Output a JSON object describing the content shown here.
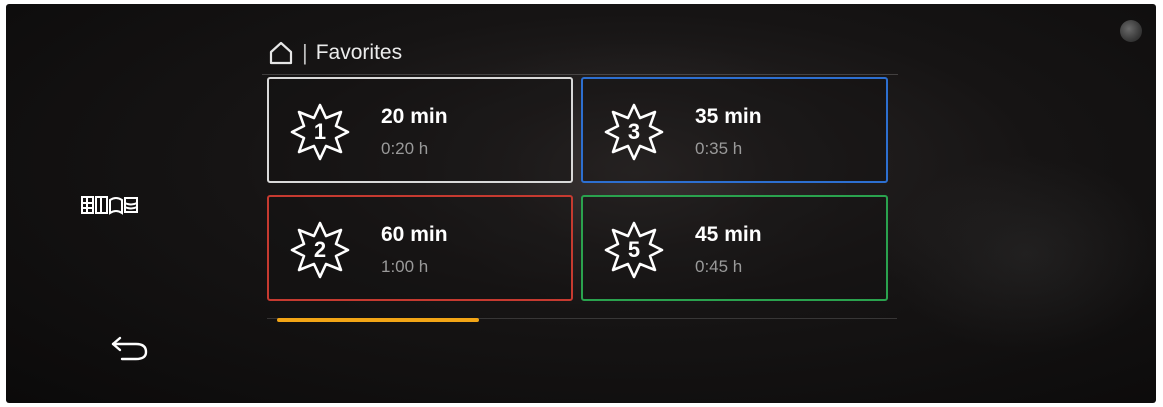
{
  "header": {
    "separator": "|",
    "title": "Favorites"
  },
  "favorites": [
    {
      "number": "1",
      "label": "20 min",
      "duration": "0:20 h",
      "border_color": "#d9d9d9"
    },
    {
      "number": "3",
      "label": "35 min",
      "duration": "0:35 h",
      "border_color": "#2d6fd0"
    },
    {
      "number": "2",
      "label": "60 min",
      "duration": "1:00 h",
      "border_color": "#c63a30"
    },
    {
      "number": "5",
      "label": "45 min",
      "duration": "0:45 h",
      "border_color": "#2aa24e"
    }
  ],
  "sidebar": {
    "top_icon": "programs-grid-icon",
    "bottom_icon": "back-arrow-icon"
  },
  "page_indicator": {
    "progress": 0.32,
    "color": "#f2a516"
  }
}
